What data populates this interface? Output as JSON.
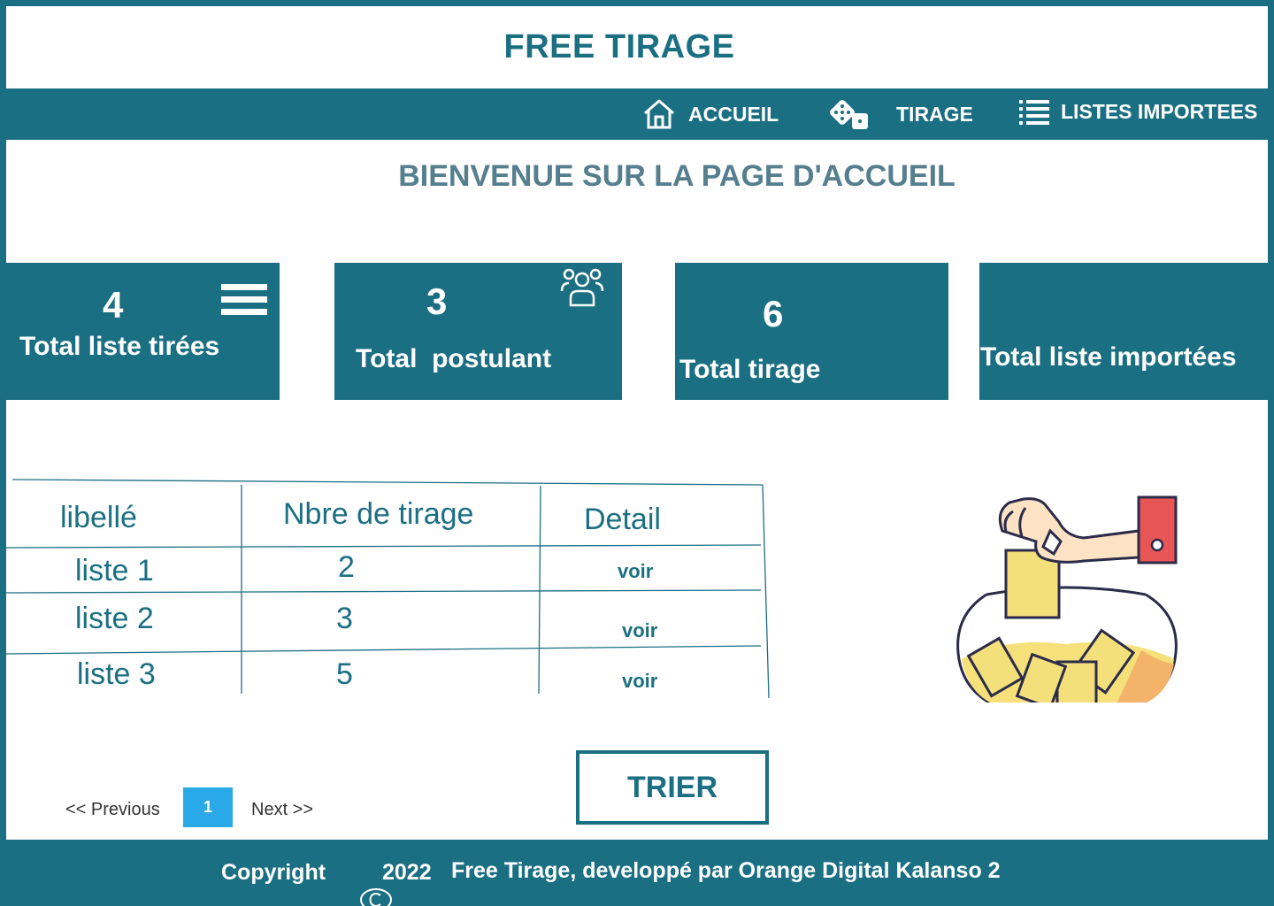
{
  "header": {
    "title": "FREE TIRAGE"
  },
  "nav": {
    "items": [
      {
        "label": "ACCUEIL",
        "icon": "home-icon"
      },
      {
        "label": "TIRAGE",
        "icon": "dice-icon"
      },
      {
        "label": "LISTES IMPORTEES",
        "icon": "list-icon"
      }
    ]
  },
  "welcome": "BIENVENUE SUR LA PAGE D'ACCUEIL",
  "cards": [
    {
      "value": "4",
      "label": "Total liste tirées",
      "icon": "menu-icon"
    },
    {
      "value": "3",
      "label": "Total  postulant",
      "icon": "users-icon"
    },
    {
      "value": "6",
      "label": "Total tirage"
    },
    {
      "value": "",
      "label": "Total liste importées"
    }
  ],
  "table": {
    "headers": [
      "libellé",
      "Nbre de tirage",
      "Detail"
    ],
    "rows": [
      {
        "libelle": "liste 1",
        "nbre": "2",
        "detail": "voir"
      },
      {
        "libelle": "liste 2",
        "nbre": "3",
        "detail": "voir"
      },
      {
        "libelle": "liste 3",
        "nbre": "5",
        "detail": "voir"
      }
    ]
  },
  "pagination": {
    "prev": "<< Previous",
    "page": "1",
    "next": "Next  >>"
  },
  "actions": {
    "sort_label": "TRIER"
  },
  "footer": {
    "copyright": "Copyright",
    "year": "2022",
    "text": "Free Tirage, developpé par Orange Digital Kalanso 2"
  },
  "colors": {
    "primary": "#1b6f82",
    "page": "#2aa9e8",
    "heading": "#557f8e"
  }
}
